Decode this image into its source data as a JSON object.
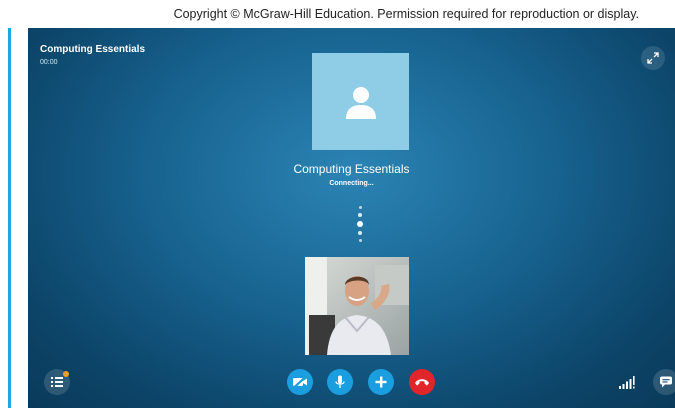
{
  "copyright": "Copyright © McGraw-Hill Education. Permission required for reproduction or display.",
  "call": {
    "title": "Computing Essentials",
    "duration": "00:00",
    "contact_name": "Computing Essentials",
    "status": "Connecting..."
  },
  "icons": {
    "expand": "expand-icon",
    "avatar": "person-icon",
    "video_off": "video-off-icon",
    "microphone": "microphone-icon",
    "add": "add-icon",
    "end_call": "end-call-icon",
    "menu": "menu-icon",
    "signal": "signal-strength-icon",
    "chat": "chat-icon"
  },
  "colors": {
    "control_blue": "#1b9ee0",
    "end_call_red": "#e0262a",
    "avatar_bg": "#8fcde6",
    "notification": "#f0a020"
  }
}
